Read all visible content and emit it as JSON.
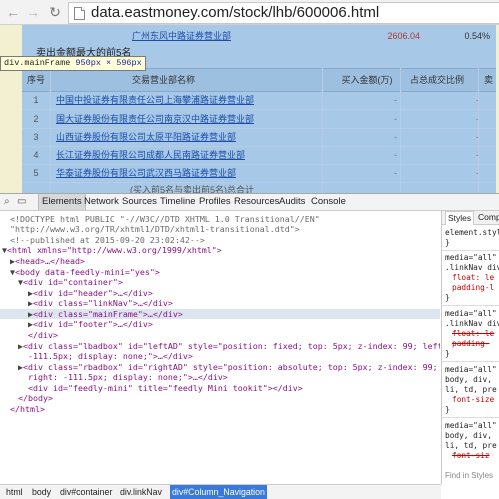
{
  "browser": {
    "url": "data.eastmoney.com/stock/lhb/600006.html",
    "back_icon": "arrow-left",
    "forward_icon": "arrow-right",
    "reload_icon": "reload"
  },
  "page": {
    "top_row": {
      "name": "广州东风中路证券营业部",
      "value": "2606.04",
      "ratio": "0.54%"
    },
    "section_title": "卖出金额最大的前5名",
    "headers": {
      "index": "序号",
      "name": "交易营业部名称",
      "buy": "买入金额(万)",
      "ratio": "占总成交比例",
      "sell": "卖"
    },
    "rows": [
      {
        "index": "1",
        "name": "中国中投证券有限责任公司上海攀浦路证券营业部",
        "buy": "-",
        "ratio": "-"
      },
      {
        "index": "2",
        "name": "国大证券股份有限责任公司南京汉中路证券营业部",
        "buy": "-",
        "ratio": "-"
      },
      {
        "index": "3",
        "name": "山西证券股份有限公司太原平阳路证券营业部",
        "buy": "-",
        "ratio": "-"
      },
      {
        "index": "4",
        "name": "长江证券股份有限公司成都人民南路证券营业部",
        "buy": "-",
        "ratio": "-"
      },
      {
        "index": "5",
        "name": "华泰证券股份有限公司武汉西马路证券营业部",
        "buy": "-",
        "ratio": "-"
      }
    ],
    "footnote": "(买入前5名与卖出前5名)总合计"
  },
  "tooltip": {
    "selector": "div.mainFrame",
    "size": "950px × 596px"
  },
  "devtools": {
    "tabs": [
      "Elements",
      "Network",
      "Sources",
      "Timeline",
      "Profiles",
      "Resources",
      "Audits",
      "Console"
    ],
    "active_tab": "Elements",
    "dom": {
      "doctype1": "<!DOCTYPE html PUBLIC \"-//W3C//DTD XHTML 1.0 Transitional//EN\"",
      "doctype2": "\"http://www.w3.org/TR/xhtml1/DTD/xhtml1-transitional.dtd\">",
      "comment": "<!--published at 2015-09-20 23:02:42-->",
      "html_open": "<html xmlns=\"http://www.w3.org/1999/xhtml\">",
      "head": "<head>…</head>",
      "body_open": "<body data-feedly-mini=\"yes\">",
      "container_open": "<div id=\"container\">",
      "header": "<div id=\"header\">…</div>",
      "linknav": "<div class=\"linkNav\">…</div>",
      "mainframe": "<div class=\"mainFrame\">…</div>",
      "footer": "<div id=\"footer\">…</div>",
      "container_close": "</div>",
      "lbadbox1": "<div class=\"lbadbox\" id=\"leftAD\" style=\"position: fixed; top: 5px; z-index: 99; left:",
      "lbadbox2": "-111.5px; display: none;\">…</div>",
      "rbadbox1": "<div class=\"rbadbox\" id=\"rightAD\" style=\"position: absolute; top: 5px; z-index: 99;",
      "rbadbox2": "right: -111.5px; display: none;\">…</div>",
      "feedly": "<div id=\"feedly-mini\" title=\"feedly Mini tookit\"></div>",
      "body_close": "</body>",
      "html_close": "</html>"
    },
    "styles": {
      "tabs": [
        "Styles",
        "Comp"
      ],
      "lines": [
        "element.styl",
        "}",
        "media=\"all\"",
        ".linkNav div",
        "float: le",
        "padding-l",
        "}",
        "media=\"all\"",
        ".linkNav div",
        "float: le",
        "padding-",
        "}",
        "media=\"all\"",
        "body, div,",
        "li, td, pre",
        "font-size",
        "}",
        "media=\"all\"",
        "body, div,",
        "li, td, pre",
        "font-siz"
      ],
      "find": "Find in Styles"
    },
    "breadcrumbs": [
      "html",
      "body",
      "div#container",
      "div.linkNav",
      "div#Column_Navigation"
    ]
  }
}
